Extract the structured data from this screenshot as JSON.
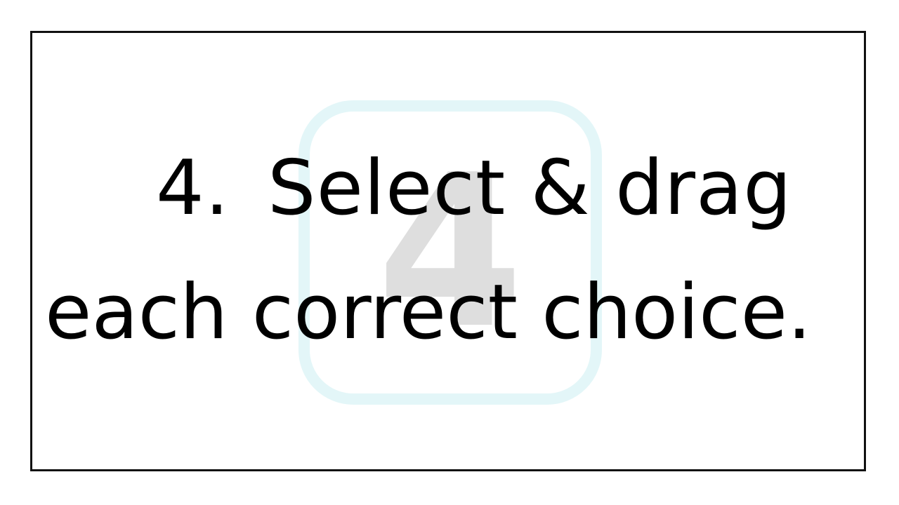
{
  "slide": {
    "badge_numeral": "4",
    "step_number": "4.",
    "line1_text": "Select & drag",
    "line2_text": "each correct choice."
  },
  "colors": {
    "border": "#111111",
    "badge_outline": "#e3f6f8",
    "badge_numeral": "#dedede",
    "text": "#000000"
  }
}
